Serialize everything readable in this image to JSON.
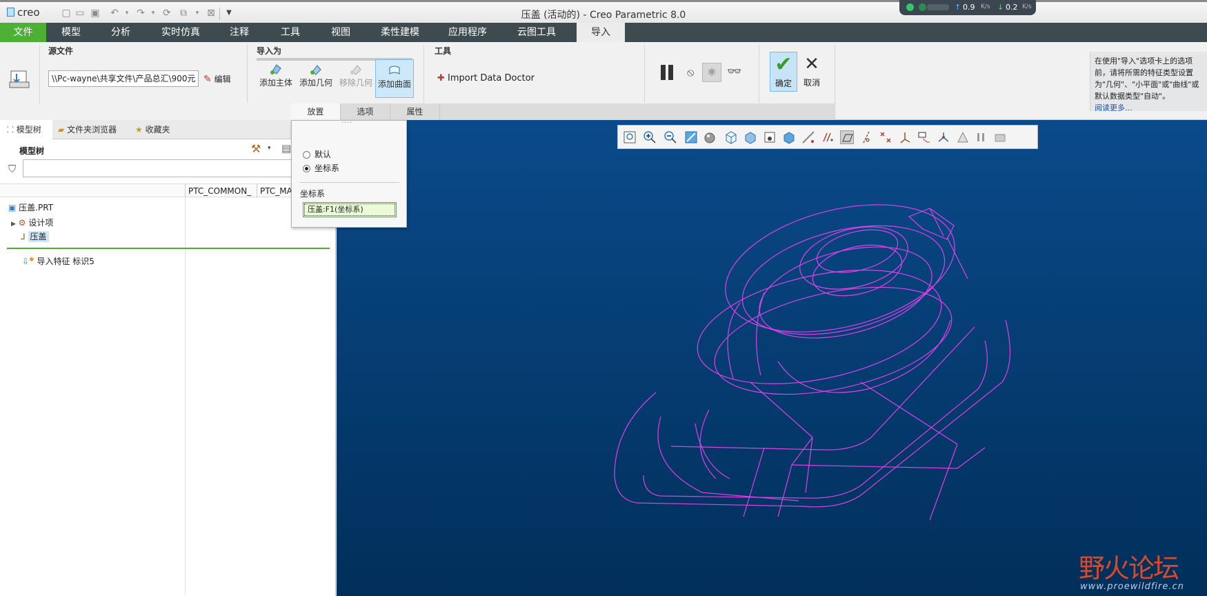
{
  "app": {
    "logo_text": "creo",
    "window_title": "压盖 (活动的) - Creo Parametric 8.0"
  },
  "net_widget": {
    "upload": "0.9",
    "upload_unit": "K/s",
    "download": "0.2",
    "download_unit": "K/s"
  },
  "menu": {
    "file": "文件",
    "model": "模型",
    "analysis": "分析",
    "simulation": "实时仿真",
    "annotate": "注释",
    "tools": "工具",
    "view": "视图",
    "flexible": "柔性建模",
    "apps": "应用程序",
    "cloud": "云图工具",
    "import": "导入"
  },
  "ribbon": {
    "source_group": "源文件",
    "source_path": "\\\\Pc-wayne\\共享文件\\产品总汇\\900元",
    "edit_label": "编辑",
    "import_as_group": "导入为",
    "add_body": "添加主体",
    "add_geometry": "添加几何",
    "remove_geometry": "移除几何",
    "add_surface": "添加曲面",
    "tools_group": "工具",
    "import_data_doctor": "Import Data Doctor",
    "ok": "确定",
    "cancel": "取消"
  },
  "subtabs": {
    "placement": "放置",
    "options": "选项",
    "properties": "属性"
  },
  "tip": {
    "text": "在使用\"导入\"选项卡上的选项前，请将所需的特征类型设置为\"几何\"、\"小平面\"或\"曲线\"或默认数据类型\"自动\"。",
    "link": "阅读更多..."
  },
  "left_tabs": {
    "model_tree": "模型树",
    "folder_browser": "文件夹浏览器",
    "favorites": "收藏夹"
  },
  "model_tree": {
    "title": "模型树",
    "col1": "PTC_COMMON_",
    "col2": "PTC_MA",
    "root": "压盖.PRT",
    "design_items": "设计项",
    "csys": "压盖",
    "import_feature": "导入特征 标识5"
  },
  "popup": {
    "opt_default": "默认",
    "opt_csys": "坐标系",
    "section_label": "坐标系",
    "csys_value": "压盖:F1(坐标系)"
  },
  "watermark": {
    "title": "野火论坛",
    "url": "www.proewildfire.cn"
  }
}
